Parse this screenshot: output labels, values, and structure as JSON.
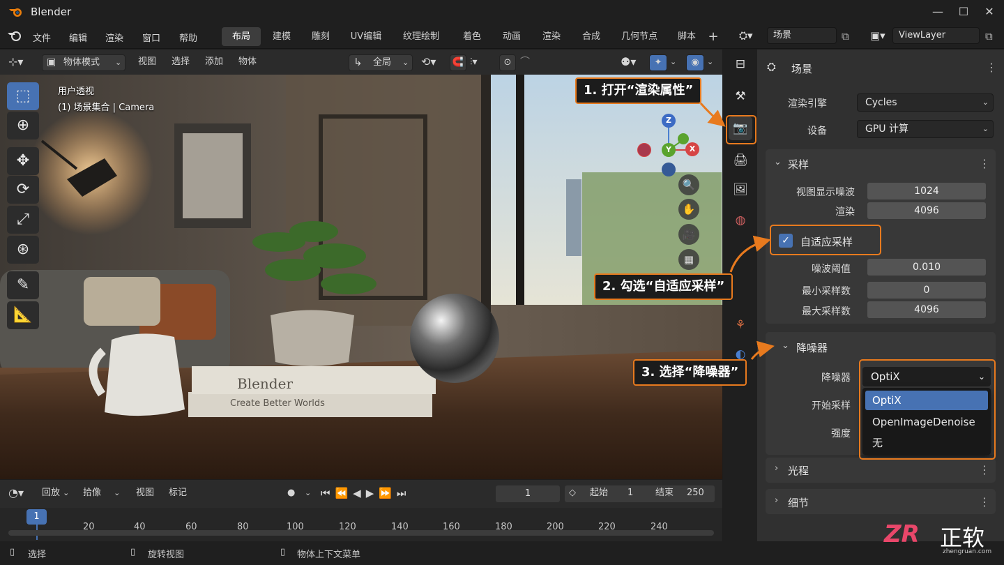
{
  "app": {
    "title": "Blender"
  },
  "menu": [
    "文件",
    "编辑",
    "渲染",
    "窗口",
    "帮助"
  ],
  "workspaces": [
    "布局",
    "建模",
    "雕刻",
    "UV编辑",
    "纹理绘制",
    "着色",
    "动画",
    "渲染",
    "合成",
    "几何节点",
    "脚本"
  ],
  "scene_selector": {
    "value": "场景"
  },
  "viewlayer_selector": {
    "value": "ViewLayer"
  },
  "viewport_header": {
    "mode": "物体模式",
    "items": [
      "视图",
      "选择",
      "添加",
      "物体"
    ],
    "transform": "全局"
  },
  "viewport": {
    "label_line1": "用户透视",
    "label_line2": "(1) 场景集合 | Camera"
  },
  "gizmo": {
    "z": "Z",
    "y": "Y",
    "x": "X"
  },
  "scene_image": {
    "book_title": "Blender",
    "book_subtitle": "Create  Better  Worlds"
  },
  "properties": {
    "header": "场景",
    "render_engine_label": "渲染引擎",
    "render_engine": "Cycles",
    "device_label": "设备",
    "device": "GPU 计算",
    "sampling": {
      "title": "采样",
      "viewport_noise_label": "视图显示噪波",
      "viewport_noise": "1024",
      "render_label": "渲染",
      "render": "4096",
      "adaptive_label": "自适应采样",
      "adaptive_checked": true,
      "noise_threshold_label": "噪波阈值",
      "noise_threshold": "0.010",
      "min_samples_label": "最小采样数",
      "min_samples": "0",
      "max_samples_label": "最大采样数",
      "max_samples": "4096"
    },
    "denoise": {
      "title": "降噪器",
      "denoiser_label": "降噪器",
      "denoiser_value": "OptiX",
      "start_sample_label": "开始采样",
      "strength_label": "强度",
      "options": [
        "OptiX",
        "OpenImageDenoise",
        "无"
      ],
      "selected_option": "OptiX"
    },
    "light_paths": "光程",
    "details": "细节"
  },
  "callouts": {
    "step1": "1. 打开“渲染属性”",
    "step2": "2. 勾选“自适应采样”",
    "step3": "3. 选择“降噪器”"
  },
  "timeline": {
    "playback": "回放",
    "keying": "拾像",
    "view": "视图",
    "marker": "标记",
    "current_frame": "1",
    "start_label": "起始",
    "start": "1",
    "end_label": "结束",
    "end": "250",
    "ticks": [
      "20",
      "40",
      "60",
      "80",
      "100",
      "120",
      "140",
      "160",
      "180",
      "200",
      "220",
      "240"
    ],
    "playhead": "1"
  },
  "status": {
    "select": "选择",
    "rotate": "旋转视图",
    "context_menu": "物体上下文菜单"
  },
  "watermark": {
    "brand": "正软",
    "url": "zhengruan.com"
  },
  "colors": {
    "accent": "#4772b3",
    "callout": "#e87a1e",
    "panel": "#383838"
  }
}
